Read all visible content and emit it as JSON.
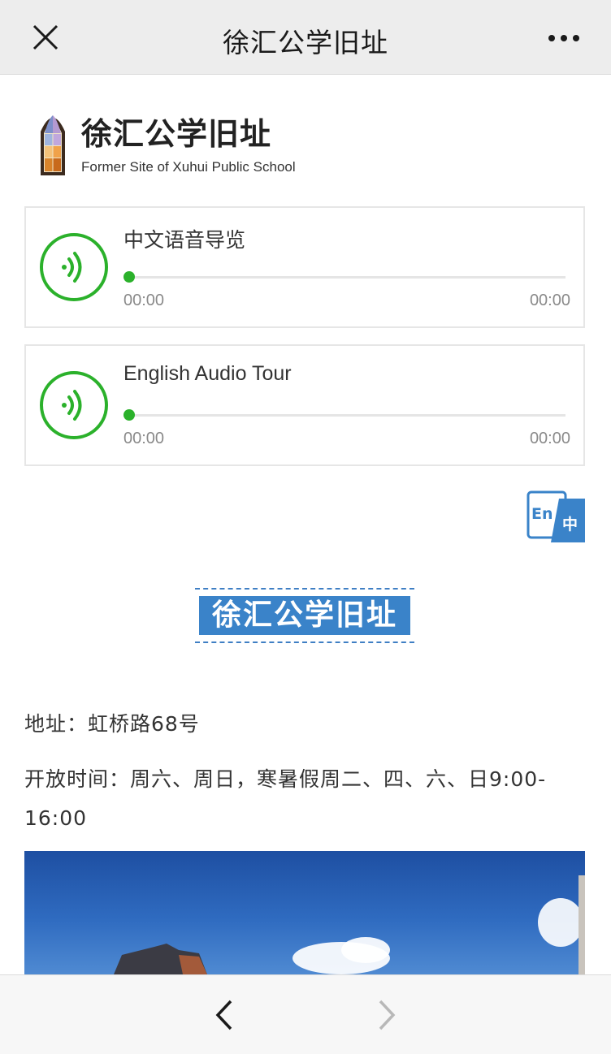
{
  "topbar": {
    "title": "徐汇公学旧址",
    "close_icon": "close-icon",
    "more_icon": "more-dots-icon"
  },
  "header": {
    "name_cn": "徐汇公学旧址",
    "name_en": "Former Site of Xuhui Public School",
    "logo_icon": "church-window-logo"
  },
  "players": [
    {
      "title": "中文语音导览",
      "time_start": "00:00",
      "time_end": "00:00",
      "progress": 0
    },
    {
      "title": "English Audio Tour",
      "time_start": "00:00",
      "time_end": "00:00",
      "progress": 0
    }
  ],
  "language_toggle": {
    "en": "En",
    "zh": "中"
  },
  "section_title": "徐汇公学旧址",
  "info": {
    "address": "地址：虹桥路68号",
    "hours_line1": "开放时间：周六、周日，寒暑假周二、四、六、日9:00-",
    "hours_line2": "16:00"
  },
  "colors": {
    "accent_green": "#2bb12b",
    "title_blue": "#3a83c9",
    "topbar_bg": "#ededed"
  }
}
